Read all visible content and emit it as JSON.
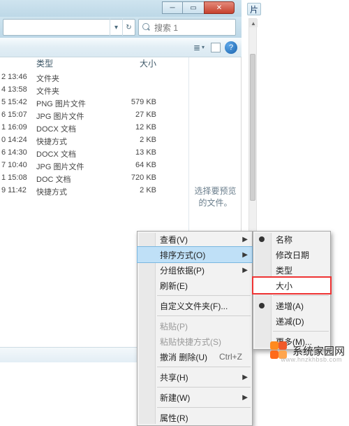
{
  "window": {
    "pian_tab": "片",
    "search_placeholder": "搜索 1",
    "preview_hint": "选择要预览的文件。"
  },
  "columns": {
    "type": "类型",
    "size": "大小"
  },
  "rows": [
    {
      "date": "2 13:46",
      "type": "文件夹",
      "size": ""
    },
    {
      "date": "4 13:58",
      "type": "文件夹",
      "size": ""
    },
    {
      "date": "5 15:42",
      "type": "PNG 图片文件",
      "size": "579 KB"
    },
    {
      "date": "6 15:07",
      "type": "JPG 图片文件",
      "size": "27 KB"
    },
    {
      "date": "1 16:09",
      "type": "DOCX 文档",
      "size": "12 KB"
    },
    {
      "date": "0 14:24",
      "type": "快捷方式",
      "size": "2 KB"
    },
    {
      "date": "6 14:30",
      "type": "DOCX 文档",
      "size": "13 KB"
    },
    {
      "date": "7 10:40",
      "type": "JPG 图片文件",
      "size": "64 KB"
    },
    {
      "date": "1 15:08",
      "type": "DOC 文档",
      "size": "720 KB"
    },
    {
      "date": "9 11:42",
      "type": "快捷方式",
      "size": "2 KB"
    }
  ],
  "menu1": {
    "view": "查看(V)",
    "sort": "排序方式(O)",
    "group": "分组依据(P)",
    "refresh": "刷新(E)",
    "customize": "自定义文件夹(F)...",
    "paste": "粘贴(P)",
    "paste_shortcut": "粘贴快捷方式(S)",
    "undo_delete": "撤消 删除(U)",
    "undo_shortcut": "Ctrl+Z",
    "share": "共享(H)",
    "new": "新建(W)",
    "props": "属性(R)"
  },
  "menu2": {
    "name": "名称",
    "date": "修改日期",
    "type": "类型",
    "size": "大小",
    "asc": "递增(A)",
    "desc": "递减(D)",
    "more": "更多(M)..."
  },
  "watermark": {
    "title": "系统家园网",
    "url": "www.hnzkhbsb.com"
  }
}
